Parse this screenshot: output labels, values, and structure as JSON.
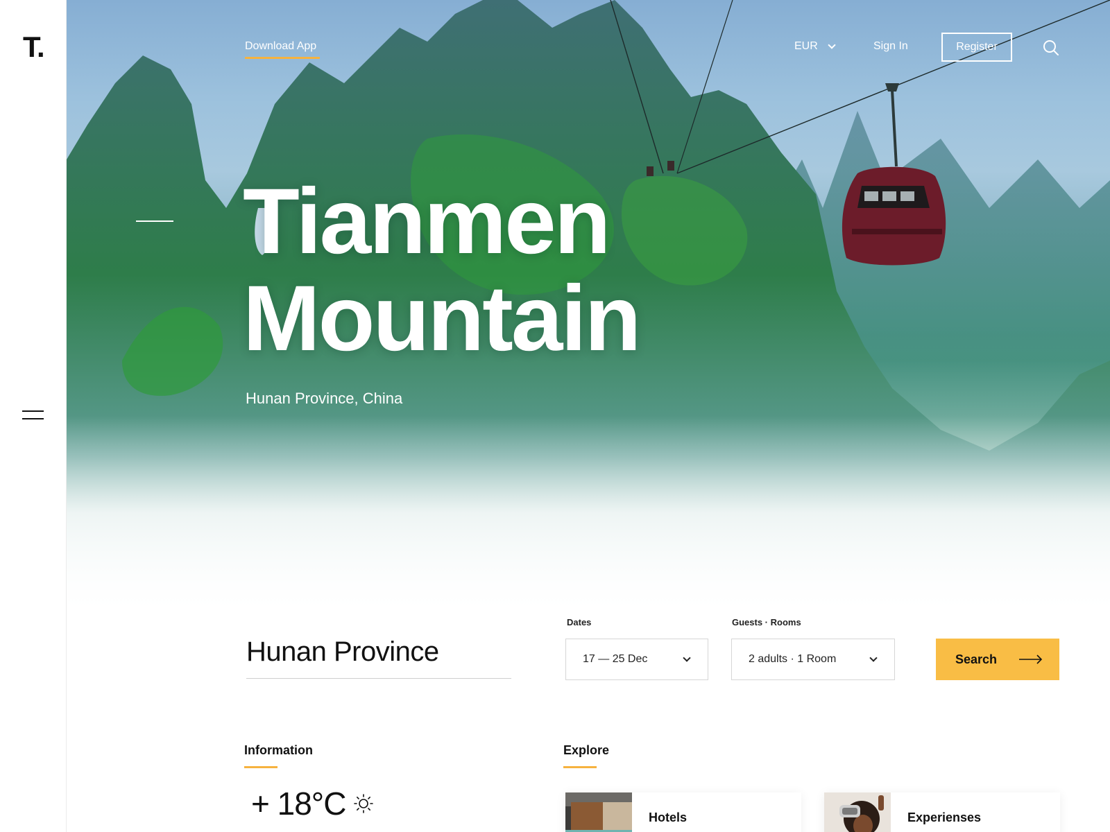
{
  "brand": {
    "logo": "T."
  },
  "nav": {
    "download_app": "Download App",
    "currency": "EUR",
    "sign_in": "Sign In",
    "register": "Register"
  },
  "hero": {
    "title_line1": "Tianmen",
    "title_line2": "Mountain",
    "subtitle": "Hunan Province, China"
  },
  "booking": {
    "destination": "Hunan Province",
    "dates_label": "Dates",
    "dates_value": "17 — 25 Dec",
    "guests_label": "Guests  ·  Rooms",
    "guests_value": "2 adults  ·  1 Room",
    "search_label": "Search"
  },
  "information": {
    "title": "Information",
    "temperature": "+ 18°C"
  },
  "explore": {
    "title": "Explore",
    "cards": [
      {
        "label": "Hotels"
      },
      {
        "label": "Experienses"
      }
    ]
  },
  "colors": {
    "accent": "#f6b23f",
    "search_button": "#f9bd45",
    "text": "#111111"
  },
  "icons": [
    "menu-icon",
    "chevron-down-icon",
    "search-icon",
    "arrow-right-icon",
    "sun-icon"
  ]
}
